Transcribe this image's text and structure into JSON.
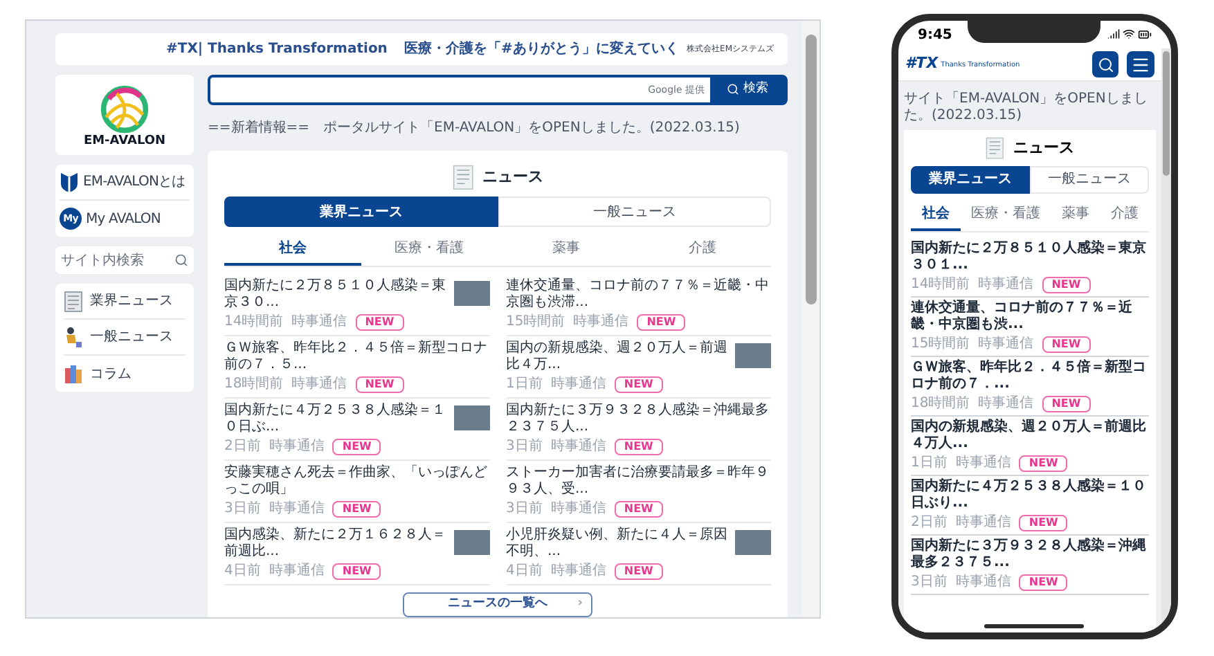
{
  "desktop": {
    "banner": {
      "tagline": "#TX| Thanks Transformation",
      "slogan": "医療・介護を「#ありがとう」に変えていく",
      "company": "株式会社EMシステムズ"
    },
    "logo": {
      "name": "EM-AVALON"
    },
    "sidebar_links": [
      {
        "kind": "shield",
        "label": "EM-AVALONとは"
      },
      {
        "kind": "badge",
        "icon_text": "My",
        "label": "My AVALON"
      }
    ],
    "site_search": {
      "placeholder": "サイト内検索"
    },
    "sidebar_categories": [
      {
        "kind": "newspaper",
        "label": "業界ニュース"
      },
      {
        "kind": "person",
        "label": "一般ニュース"
      },
      {
        "kind": "books",
        "label": "コラム"
      }
    ],
    "search": {
      "placeholder": "Google 提供",
      "button": "検索"
    },
    "notice": "==新着情報==　ポータルサイト「EM-AVALON」をOPENしました。(2022.03.15)",
    "news": {
      "title": "ニュース",
      "tabs": [
        {
          "label": "業界ニュース",
          "selected": true
        },
        {
          "label": "一般ニュース",
          "selected": false
        }
      ],
      "categories": [
        {
          "label": "社会",
          "selected": true
        },
        {
          "label": "医療・看護",
          "selected": false
        },
        {
          "label": "薬事",
          "selected": false
        },
        {
          "label": "介護",
          "selected": false
        }
      ],
      "items": [
        {
          "title": "国内新たに２万８５１０人感染＝東京３０...",
          "time": "14時間前",
          "source": "時事通信",
          "badge": "NEW",
          "thumbnail": true
        },
        {
          "title": "連休交通量、コロナ前の７７％＝近畿・中京圏も渋滞...",
          "time": "15時間前",
          "source": "時事通信",
          "badge": "NEW",
          "thumbnail": false
        },
        {
          "title": "ＧＷ旅客、昨年比２．４５倍＝新型コロナ前の７．５...",
          "time": "18時間前",
          "source": "時事通信",
          "badge": "NEW",
          "thumbnail": false
        },
        {
          "title": "国内の新規感染、週２０万人＝前週比４万...",
          "time": "1日前",
          "source": "時事通信",
          "badge": "NEW",
          "thumbnail": true
        },
        {
          "title": "国内新たに４万２５３８人感染＝１０日ぶ...",
          "time": "2日前",
          "source": "時事通信",
          "badge": "NEW",
          "thumbnail": true
        },
        {
          "title": "国内新たに３万９３２８人感染＝沖縄最多２３７５人...",
          "time": "3日前",
          "source": "時事通信",
          "badge": "NEW",
          "thumbnail": false
        },
        {
          "title": "安藤実穂さん死去＝作曲家、「いっぽんどっこの唄」",
          "time": "3日前",
          "source": "時事通信",
          "badge": "NEW",
          "thumbnail": false
        },
        {
          "title": "ストーカー加害者に治療要請最多＝昨年９９３人、受...",
          "time": "3日前",
          "source": "時事通信",
          "badge": "NEW",
          "thumbnail": false
        },
        {
          "title": "国内感染、新たに２万１６２８人＝前週比...",
          "time": "4日前",
          "source": "時事通信",
          "badge": "NEW",
          "thumbnail": true
        },
        {
          "title": "小児肝炎疑い例、新たに４人＝原因不明、...",
          "time": "4日前",
          "source": "時事通信",
          "badge": "NEW",
          "thumbnail": true
        }
      ],
      "more": "ニュースの一覧へ",
      "more_arrow": "›"
    }
  },
  "mobile": {
    "status": {
      "time": "9:45"
    },
    "logo": {
      "mark": "#TX",
      "text": "Thanks Transformation"
    },
    "notice": "サイト「EM-AVALON」をOPENしました。(2022.03.15)",
    "news": {
      "title": "ニュース",
      "tabs": [
        {
          "label": "業界ニュース",
          "selected": true
        },
        {
          "label": "一般ニュース",
          "selected": false
        }
      ],
      "categories": [
        {
          "label": "社会",
          "selected": true
        },
        {
          "label": "医療・看護",
          "selected": false
        },
        {
          "label": "薬事",
          "selected": false
        },
        {
          "label": "介護",
          "selected": false
        }
      ],
      "items": [
        {
          "title": "国内新たに２万８５１０人感染＝東京３０１...",
          "time": "14時間前",
          "source": "時事通信",
          "badge": "NEW"
        },
        {
          "title": "連休交通量、コロナ前の７７％＝近畿・中京圏も渋...",
          "time": "15時間前",
          "source": "時事通信",
          "badge": "NEW"
        },
        {
          "title": "ＧＷ旅客、昨年比２．４５倍＝新型コロナ前の７．...",
          "time": "18時間前",
          "source": "時事通信",
          "badge": "NEW"
        },
        {
          "title": "国内の新規感染、週２０万人＝前週比４万人...",
          "time": "1日前",
          "source": "時事通信",
          "badge": "NEW"
        },
        {
          "title": "国内新たに４万２５３８人感染＝１０日ぶり...",
          "time": "2日前",
          "source": "時事通信",
          "badge": "NEW"
        },
        {
          "title": "国内新たに３万９３２８人感染＝沖縄最多２３７５...",
          "time": "3日前",
          "source": "時事通信",
          "badge": "NEW"
        }
      ]
    }
  }
}
